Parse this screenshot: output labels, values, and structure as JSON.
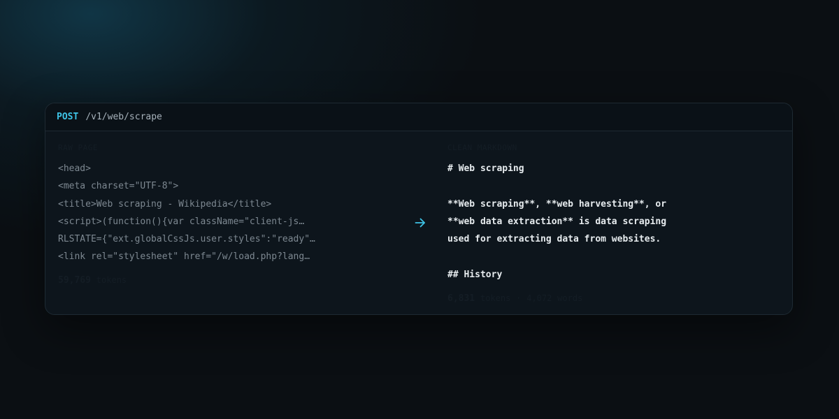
{
  "request": {
    "method": "POST",
    "path": "/v1/web/scrape"
  },
  "raw": {
    "label": "RAW PAGE",
    "lines": [
      "<head>",
      "<meta charset=\"UTF-8\">",
      "<title>Web scraping - Wikipedia</title>",
      "<script>(function(){var className=\"client-js…",
      "RLSTATE={\"ext.globalCssJs.user.styles\":\"ready\"…",
      "<link rel=\"stylesheet\" href=\"/w/load.php?lang…"
    ],
    "token_count": "59,769",
    "token_unit": "tokens"
  },
  "arrow_icon": "arrow-right-icon",
  "accent_color": "#3ec3e6",
  "markdown": {
    "label": "CLEAN MARKDOWN",
    "lines": [
      "# Web scraping",
      "",
      "**Web scraping**, **web harvesting**, or",
      "**web data extraction** is data scraping",
      "used for extracting data from websites.",
      "",
      "## History"
    ],
    "token_count": "6,831",
    "token_unit": "tokens",
    "separator": "·",
    "word_count": "4,072",
    "word_unit": "words"
  }
}
